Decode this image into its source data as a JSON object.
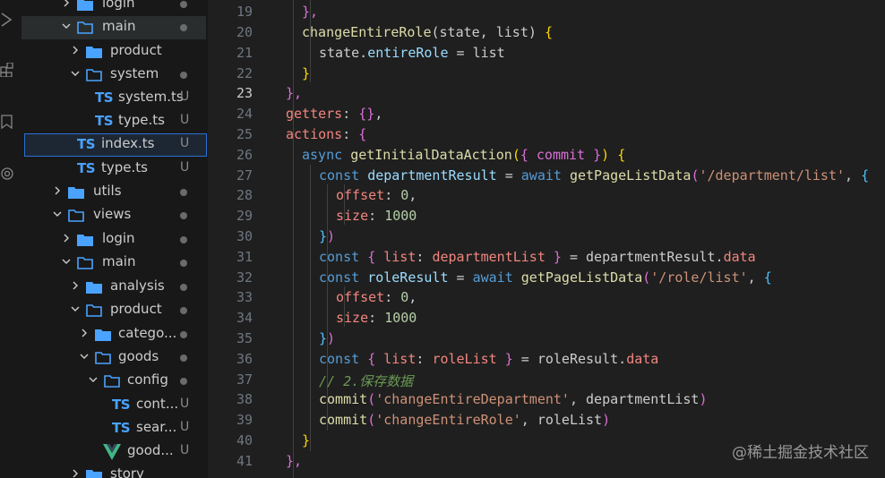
{
  "explorer": {
    "items": [
      {
        "label": "login",
        "status": "dot"
      },
      {
        "label": "main",
        "status": "dot"
      },
      {
        "label": "product",
        "status": ""
      },
      {
        "label": "system",
        "status": "dot"
      },
      {
        "label": "system.ts",
        "status": "U"
      },
      {
        "label": "type.ts",
        "status": "U"
      },
      {
        "label": "index.ts",
        "status": "U"
      },
      {
        "label": "type.ts",
        "status": "U"
      },
      {
        "label": "utils",
        "status": "dot"
      },
      {
        "label": "views",
        "status": "dot"
      },
      {
        "label": "login",
        "status": "dot"
      },
      {
        "label": "main",
        "status": "dot"
      },
      {
        "label": "analysis",
        "status": "dot"
      },
      {
        "label": "product",
        "status": "dot"
      },
      {
        "label": "catego...",
        "status": "dot"
      },
      {
        "label": "goods",
        "status": "dot"
      },
      {
        "label": "config",
        "status": "dot"
      },
      {
        "label": "cont...",
        "status": "U"
      },
      {
        "label": "sear...",
        "status": "U"
      },
      {
        "label": "good...",
        "status": "U"
      },
      {
        "label": "story",
        "status": ""
      }
    ],
    "ts_badge": "TS"
  },
  "editor": {
    "line_numbers": [
      "19",
      "20",
      "21",
      "22",
      "23",
      "24",
      "25",
      "26",
      "27",
      "28",
      "29",
      "30",
      "31",
      "32",
      "33",
      "34",
      "35",
      "36",
      "37",
      "38",
      "39",
      "40",
      "41"
    ],
    "t19": {
      "a": "},"
    },
    "t20": {
      "a": "changeEntireRole",
      "b": "(state, list) ",
      "c": "{"
    },
    "t21": {
      "a": "state.",
      "b": "entireRole",
      "c": " = list"
    },
    "t22": {
      "a": "}"
    },
    "t23": {
      "a": "},"
    },
    "t24": {
      "a": "getters",
      "b": ": ",
      "c": "{}",
      ",": ","
    },
    "t25": {
      "a": "actions",
      "b": ": ",
      "c": "{"
    },
    "t26": {
      "a": "async ",
      "b": "getInitialDataAction",
      "c": "(",
      "d": "{ commit }",
      "e": ")",
      "f": " {"
    },
    "t27": {
      "a": "const ",
      "b": "departmentResult",
      "c": " = ",
      "d": "await ",
      "e": "getPageListData",
      "f": "(",
      "g": "'/department/list'",
      "h": ", ",
      "i": "{"
    },
    "t28": {
      "a": "offset",
      "b": ": ",
      "c": "0",
      ",": ","
    },
    "t29": {
      "a": "size",
      "b": ": ",
      "c": "1000"
    },
    "t30": {
      "a": "}",
      "b": ")"
    },
    "t31": {
      "a": "const ",
      "b": "{ ",
      "c": "list",
      "d": ": ",
      "e": "departmentList",
      "f": " }",
      "g": " = departmentResult.",
      "h": "data"
    },
    "t32": {
      "a": "const ",
      "b": "roleResult",
      "c": " = ",
      "d": "await ",
      "e": "getPageListData",
      "f": "(",
      "g": "'/role/list'",
      "h": ", ",
      "i": "{"
    },
    "t33": {
      "a": "offset",
      "b": ": ",
      "c": "0",
      ",": ","
    },
    "t34": {
      "a": "size",
      "b": ": ",
      "c": "1000"
    },
    "t35": {
      "a": "}",
      "b": ")"
    },
    "t36": {
      "a": "const ",
      "b": "{ ",
      "c": "list",
      "d": ": ",
      "e": "roleList",
      "f": " }",
      "g": " = roleResult.",
      "h": "data"
    },
    "t37": {
      "a": "// 2.保存数据"
    },
    "t38": {
      "a": "commit",
      "b": "(",
      "c": "'changeEntireDepartment'",
      "d": ", departmentList",
      "e": ")"
    },
    "t39": {
      "a": "commit",
      "b": "(",
      "c": "'changeEntireRole'",
      "d": ", roleList",
      "e": ")"
    },
    "t40": {
      "a": "}"
    },
    "t41": {
      "a": "},"
    }
  },
  "watermark": "@稀土掘金技术社区",
  "colors": {
    "keyword": "#569cd6",
    "function": "#dcdcaa",
    "property": "#9cdcfe",
    "string": "#ce9178",
    "number": "#b5cea8",
    "comment": "#6a9955",
    "ts_icon": "#4aa3ff",
    "folder": "#4aa3ff"
  }
}
